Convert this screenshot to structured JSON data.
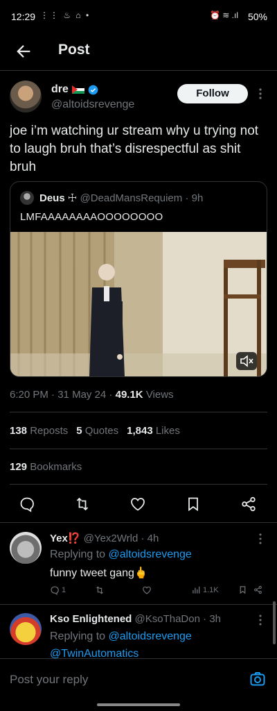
{
  "status_bar": {
    "time": "12:29",
    "left_icons": "⋮⋮ ♨ ⌂ •",
    "right_icons": "⏰ ≋ .ıl",
    "battery": "50%"
  },
  "header": {
    "title": "Post"
  },
  "tweet": {
    "author_name": "dre",
    "author_handle": "@altoidsrevenge",
    "follow_label": "Follow",
    "text": "joe i’m watching ur stream why u trying not to laugh bruh that’s disrespectful as shit bruh",
    "quote": {
      "name": "Deus ☩",
      "handle": "@DeadMansRequiem",
      "separator": "·",
      "time": "9h",
      "text": "LMFAAAAAAAAOOOOOOOO"
    },
    "time": "6:20 PM",
    "date": "31 May 24",
    "views_count": "49.1K",
    "views_label": "Views",
    "reposts_count": "138",
    "reposts_label": "Reposts",
    "quotes_count": "5",
    "quotes_label": "Quotes",
    "likes_count": "1,843",
    "likes_label": "Likes",
    "bookmarks_count": "129",
    "bookmarks_label": "Bookmarks"
  },
  "replies": [
    {
      "name": "Yex⁉️",
      "handle": "@Yex2Wrld",
      "time": "4h",
      "replying_prefix": "Replying to",
      "replying_to": "@altoidsrevenge",
      "text": "funny tweet gang🖕",
      "comments": "1",
      "views": "1.1K"
    },
    {
      "name": "Kso Enlightened",
      "handle": "@KsoThaDon",
      "time": "3h",
      "replying_prefix": "Replying to",
      "replying_to": "@altoidsrevenge",
      "replying_to_2": "@TwinAutomatics"
    }
  ],
  "composer": {
    "placeholder": "Post your reply"
  },
  "colors": {
    "accent": "#1d9bf0",
    "muted": "#71767b",
    "border": "#2f3336"
  }
}
